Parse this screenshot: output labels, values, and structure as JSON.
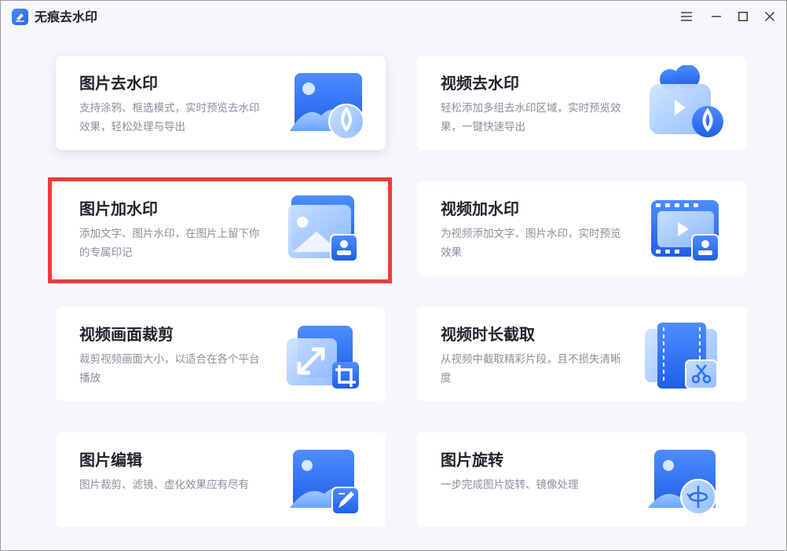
{
  "app": {
    "title": "无痕去水印",
    "logo_icon": "eraser-icon"
  },
  "window_controls": {
    "menu_icon": "menu-icon",
    "minimize_icon": "minimize-icon",
    "maximize_icon": "maximize-icon",
    "close_icon": "close-icon"
  },
  "cards": [
    {
      "title": "图片去水印",
      "desc": "支持涂鸦、框选模式，实时预览去水印效果，轻松处理与导出",
      "icon": "image-remove-watermark-icon"
    },
    {
      "title": "视频去水印",
      "desc": "轻松添加多组去水印区域，实时预览效果，一键快速导出",
      "icon": "video-remove-watermark-icon"
    },
    {
      "title": "图片加水印",
      "desc": "添加文字、图片水印，在图片上留下你的专属印记",
      "icon": "image-add-watermark-icon"
    },
    {
      "title": "视频加水印",
      "desc": "为视频添加文字、图片水印，实时预览效果",
      "icon": "video-add-watermark-icon"
    },
    {
      "title": "视频画面裁剪",
      "desc": "裁剪视频画面大小，以适合在各个平台播放",
      "icon": "video-crop-icon"
    },
    {
      "title": "视频时长截取",
      "desc": "从视频中截取精彩片段，且不损失清晰度",
      "icon": "video-trim-icon"
    },
    {
      "title": "图片编辑",
      "desc": "图片裁剪、滤镜、虚化效果应有尽有",
      "icon": "image-edit-icon"
    },
    {
      "title": "图片旋转",
      "desc": "一步完成图片旋转、镜像处理",
      "icon": "image-rotate-icon"
    }
  ],
  "colors": {
    "accent": "#2b6ef0",
    "accent_light": "#7db3ff",
    "highlight": "#ee3a3a",
    "background": "#f6f7fa"
  }
}
